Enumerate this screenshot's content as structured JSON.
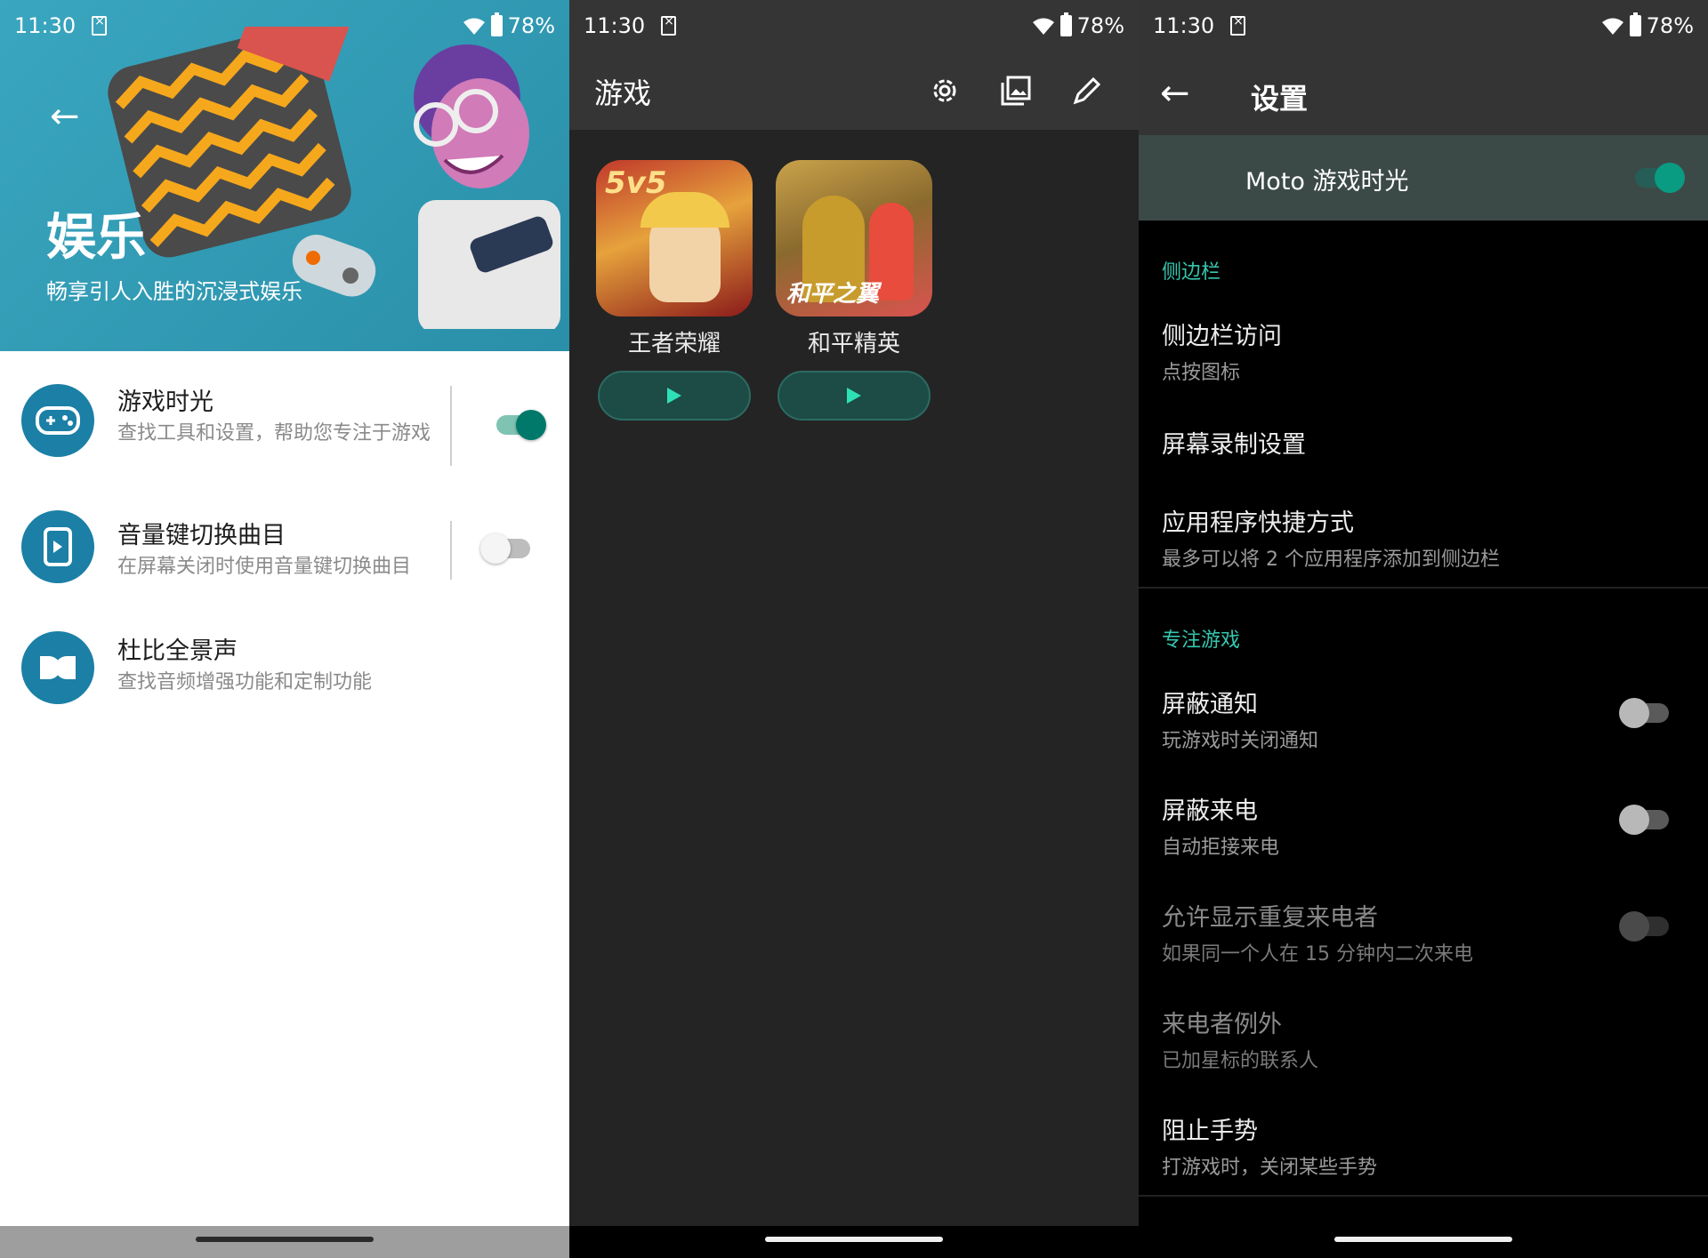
{
  "status": {
    "time": "11:30",
    "battery": "78%"
  },
  "screen1": {
    "hero_title": "娱乐",
    "hero_subtitle": "畅享引人入胜的沉浸式娱乐",
    "items": [
      {
        "title": "游戏时光",
        "desc": "查找工具和设置，帮助您专注于游戏",
        "toggle": "on",
        "icon": "gamepad-icon"
      },
      {
        "title": "音量键切换曲目",
        "desc": "在屏幕关闭时使用音量键切换曲目",
        "toggle": "off",
        "icon": "volume-keys-icon"
      },
      {
        "title": "杜比全景声",
        "desc": "查找音频增强功能和定制功能",
        "icon": "dolby-icon"
      }
    ]
  },
  "screen2": {
    "title": "游戏",
    "actions": [
      "settings-icon",
      "gallery-icon",
      "edit-icon"
    ],
    "games": [
      {
        "name": "王者荣耀",
        "badge": "5v5"
      },
      {
        "name": "和平精英",
        "badge": "和平之翼"
      }
    ]
  },
  "screen3": {
    "title": "设置",
    "master": {
      "label": "Moto 游戏时光",
      "toggle": "on"
    },
    "section_sidebar": "侧边栏",
    "sidebar_items": [
      {
        "title": "侧边栏访问",
        "desc": "点按图标"
      },
      {
        "title": "屏幕录制设置",
        "desc": ""
      },
      {
        "title": "应用程序快捷方式",
        "desc": "最多可以将 2 个应用程序添加到侧边栏"
      }
    ],
    "section_focus": "专注游戏",
    "focus_items": [
      {
        "title": "屏蔽通知",
        "desc": "玩游戏时关闭通知",
        "toggle": "off"
      },
      {
        "title": "屏蔽来电",
        "desc": "自动拒接来电",
        "toggle": "off"
      },
      {
        "title": "允许显示重复来电者",
        "desc": "如果同一个人在 15 分钟内二次来电",
        "toggle": "disabled"
      },
      {
        "title": "来电者例外",
        "desc": "已加星标的联系人"
      },
      {
        "title": "阻止手势",
        "desc": "打游戏时，关闭某些手势"
      }
    ]
  },
  "colors": {
    "accent": "#00796b",
    "section": "#35c7ae",
    "icon_bg": "#1b7fa6"
  }
}
